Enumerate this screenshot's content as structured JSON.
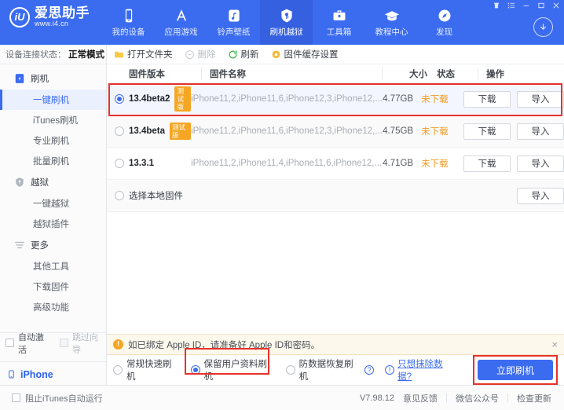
{
  "header": {
    "brand_title": "爱思助手",
    "brand_sub": "www.i4.cn",
    "brand_mark": "iU",
    "accent_color": "#3b6cf0",
    "tabs": [
      {
        "label": "我的设备",
        "icon": "phone-icon",
        "active": false
      },
      {
        "label": "应用游戏",
        "icon": "appstore-icon",
        "active": false
      },
      {
        "label": "铃声壁纸",
        "icon": "music-icon",
        "active": false
      },
      {
        "label": "刷机越狱",
        "icon": "key-icon",
        "active": true
      },
      {
        "label": "工具箱",
        "icon": "toolbox-icon",
        "active": false
      },
      {
        "label": "教程中心",
        "icon": "graduation-cap-icon",
        "active": false
      },
      {
        "label": "发现",
        "icon": "compass-icon",
        "active": false
      }
    ],
    "window_controls": [
      "skin-icon",
      "menu-icon",
      "minimize-icon",
      "maximize-icon",
      "close-icon"
    ],
    "download_icon": "download-arrow-icon"
  },
  "sidebar": {
    "status_label": "设备连接状态：",
    "status_value": "正常模式",
    "groups": [
      {
        "label": "刷机",
        "icon": "flash-device-icon",
        "children": [
          {
            "label": "一键刷机",
            "active": true
          },
          {
            "label": "iTunes刷机",
            "active": false
          },
          {
            "label": "专业刷机",
            "active": false
          },
          {
            "label": "批量刷机",
            "active": false
          }
        ]
      },
      {
        "label": "越狱",
        "icon": "shield-icon",
        "children": [
          {
            "label": "一键越狱",
            "active": false
          },
          {
            "label": "越狱插件",
            "active": false
          }
        ]
      },
      {
        "label": "更多",
        "icon": "more-lines-icon",
        "children": [
          {
            "label": "其他工具",
            "active": false
          },
          {
            "label": "下载固件",
            "active": false
          },
          {
            "label": "高级功能",
            "active": false
          }
        ]
      }
    ],
    "options": [
      {
        "label": "自动激活",
        "checked": false,
        "disabled": false
      },
      {
        "label": "跳过向导",
        "checked": false,
        "disabled": true
      }
    ],
    "device": {
      "label": "iPhone",
      "icon": "phone-icon"
    }
  },
  "toolbar": {
    "buttons": [
      {
        "label": "打开文件夹",
        "icon": "folder-icon",
        "disabled": false
      },
      {
        "label": "删除",
        "icon": "delete-icon",
        "disabled": true
      },
      {
        "label": "刷新",
        "icon": "refresh-icon",
        "disabled": false
      },
      {
        "label": "固件缓存设置",
        "icon": "gear-icon",
        "disabled": false
      }
    ]
  },
  "table": {
    "columns": {
      "version": "固件版本",
      "name": "固件名称",
      "size": "大小",
      "state": "状态",
      "ops": "操作"
    },
    "rows": [
      {
        "version": "13.4beta2",
        "tag": "测试版",
        "name": "iPhone11,2,iPhone11,6,iPhone12,3,iPhone12,...",
        "size": "4.77GB",
        "state": "未下载",
        "selected": true,
        "highlighted": true,
        "buttons": [
          "下载",
          "导入"
        ]
      },
      {
        "version": "13.4beta",
        "tag": "测试版",
        "name": "iPhone11,2,iPhone11,6,iPhone12,3,iPhone12,...",
        "size": "4.75GB",
        "state": "未下载",
        "selected": false,
        "highlighted": false,
        "buttons": [
          "下载",
          "导入"
        ]
      },
      {
        "version": "13.3.1",
        "tag": "",
        "name": "iPhone11,2,iPhone11,4,iPhone11,6,iPhone12,...",
        "size": "4.71GB",
        "state": "未下载",
        "selected": false,
        "highlighted": false,
        "buttons": [
          "下载",
          "导入"
        ]
      },
      {
        "version": "选择本地固件",
        "tag": "",
        "name": "",
        "size": "",
        "state": "",
        "selected": false,
        "highlighted": false,
        "buttons": [
          "导入"
        ]
      }
    ]
  },
  "notice": {
    "icon": "warning-icon",
    "text": "如已绑定 Apple ID，请准备好 Apple ID和密码。",
    "close": "×"
  },
  "action_bar": {
    "modes": [
      {
        "label": "常规快速刷机",
        "checked": false,
        "highlighted": false
      },
      {
        "label": "保留用户资料刷机",
        "checked": true,
        "highlighted": true
      },
      {
        "label": "防数据恢复刷机",
        "checked": false,
        "highlighted": false
      }
    ],
    "help_icon": "question-icon",
    "erase_link": "只想抹除数据?",
    "erase_icon": "info-icon",
    "primary_button": "立即刷机"
  },
  "footer": {
    "checkbox_label": "阻止iTunes自动运行",
    "version": "V7.98.12",
    "links": [
      "意见反馈",
      "微信公众号",
      "检查更新"
    ]
  }
}
